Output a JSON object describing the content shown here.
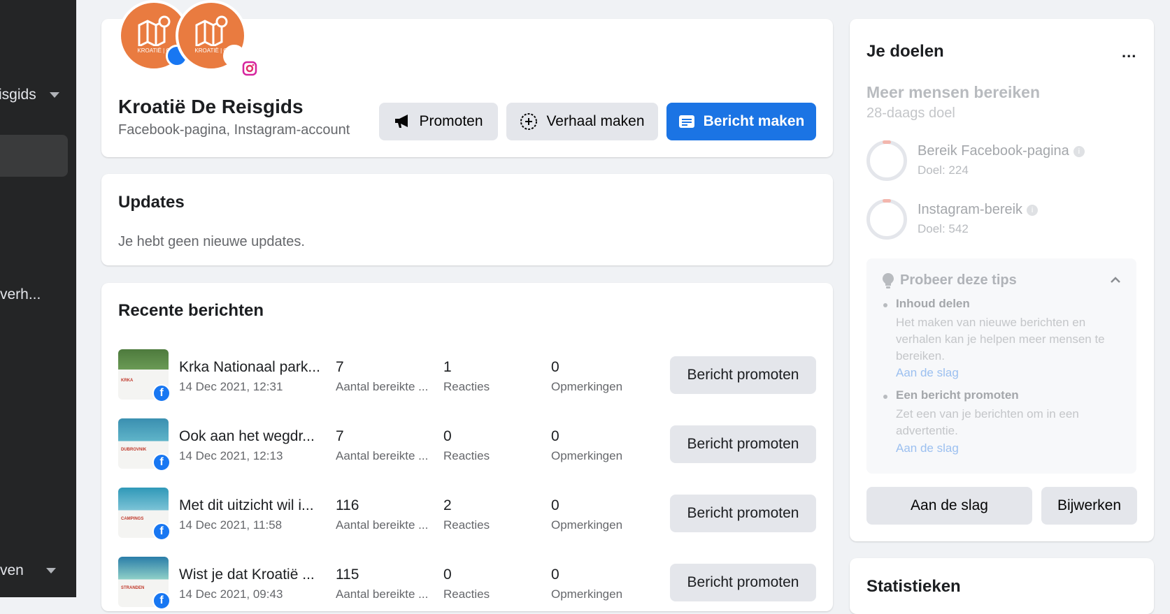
{
  "sidebar": {
    "items": [
      {
        "label": "isgids"
      },
      {
        "label": "verh..."
      },
      {
        "label": "ven"
      }
    ]
  },
  "page": {
    "name": "Kroatië De Reisgids",
    "subtitle": "Facebook-pagina, Instagram-account",
    "avatar_text_1": "KROATIË | O",
    "avatar_text_2": "KROATIË | O",
    "actions": {
      "promote": "Promoten",
      "story": "Verhaal maken",
      "post": "Bericht maken"
    }
  },
  "updates": {
    "title": "Updates",
    "message": "Je hebt geen nieuwe updates."
  },
  "recent": {
    "title": "Recente berichten",
    "posts": [
      {
        "title": "Krka Nationaal park...",
        "date": "14 Dec 2021, 12:31",
        "reach": "7",
        "reach_label": "Aantal bereikte ...",
        "reactions": "1",
        "reactions_label": "Reacties",
        "comments": "0",
        "comments_label": "Opmerkingen",
        "button": "Bericht promoten",
        "thumb_caption": "KRKA"
      },
      {
        "title": "Ook aan het wegdr...",
        "date": "14 Dec 2021, 12:13",
        "reach": "7",
        "reach_label": "Aantal bereikte ...",
        "reactions": "0",
        "reactions_label": "Reacties",
        "comments": "0",
        "comments_label": "Opmerkingen",
        "button": "Bericht promoten",
        "thumb_caption": "DUBROVNIK"
      },
      {
        "title": "Met dit uitzicht wil i...",
        "date": "14 Dec 2021, 11:58",
        "reach": "116",
        "reach_label": "Aantal bereikte ...",
        "reactions": "2",
        "reactions_label": "Reacties",
        "comments": "0",
        "comments_label": "Opmerkingen",
        "button": "Bericht promoten",
        "thumb_caption": "CAMPINGS"
      },
      {
        "title": "Wist je dat Kroatië ...",
        "date": "14 Dec 2021, 09:43",
        "reach": "115",
        "reach_label": "Aantal bereikte ...",
        "reactions": "0",
        "reactions_label": "Reacties",
        "comments": "0",
        "comments_label": "Opmerkingen",
        "button": "Bericht promoten",
        "thumb_caption": "STRANDEN"
      }
    ]
  },
  "goals": {
    "title": "Je doelen",
    "more": "...",
    "heading": "Meer mensen bereiken",
    "subheading": "28-daags doel",
    "items": [
      {
        "label": "Bereik Facebook-pagina",
        "goal": "Doel: 224",
        "info": "i"
      },
      {
        "label": "Instagram-bereik",
        "goal": "Doel: 542",
        "info": "i"
      }
    ],
    "tips": {
      "title": "Probeer deze tips",
      "items": [
        {
          "title": "Inhoud delen",
          "text": "Het maken van nieuwe berichten en verhalen kan je helpen meer mensen te bereiken.",
          "link": "Aan de slag"
        },
        {
          "title": "Een bericht promoten",
          "text": "Zet een van je berichten om in een advertentie.",
          "link": "Aan de slag"
        }
      ]
    },
    "start_button": "Aan de slag",
    "edit_button": "Bijwerken"
  },
  "stats": {
    "title": "Statistieken"
  },
  "colors": {
    "primary": "#1b74e4",
    "avatar": "#e97b40",
    "sidebar": "#242526"
  }
}
